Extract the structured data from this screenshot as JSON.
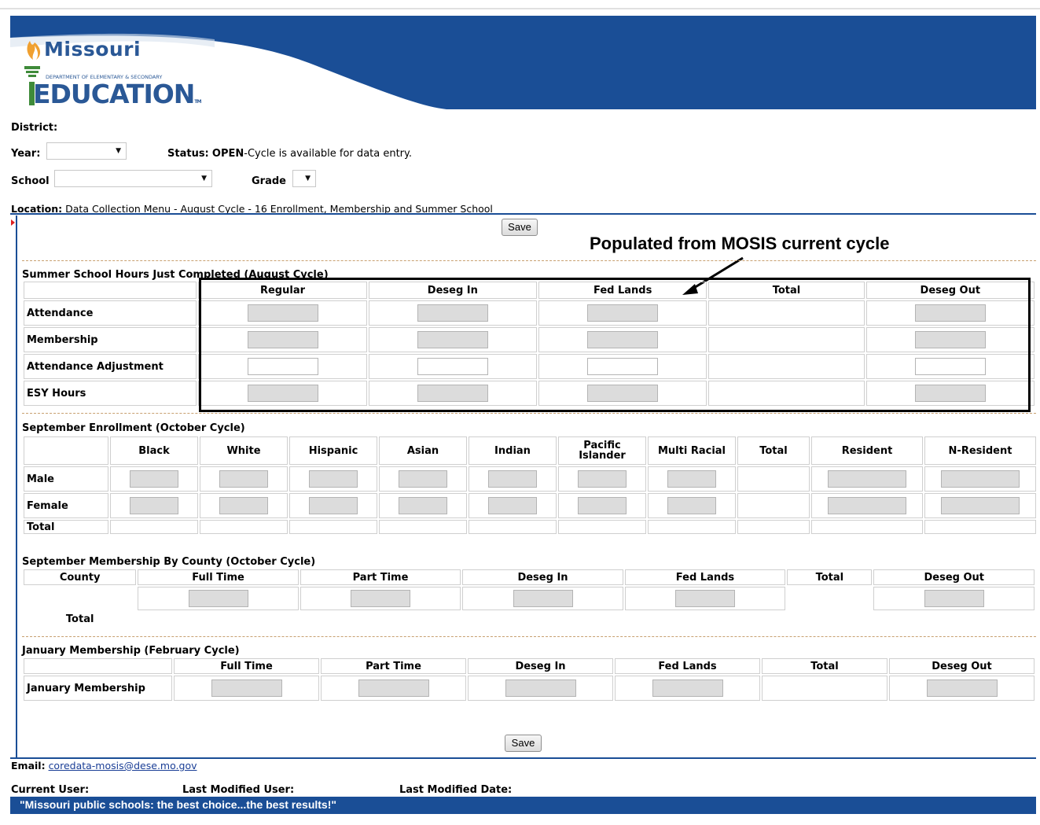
{
  "header": {
    "logo_missouri": "Missouri",
    "logo_department": "DEPARTMENT OF ELEMENTARY & SECONDARY",
    "logo_education": "EDUCATION",
    "logo_tm": "TM",
    "banner_color": "#1a4e96"
  },
  "filters": {
    "district_label": "District:",
    "year_label": "Year:",
    "year_value": "",
    "status_label": "Status:",
    "status_value": "OPEN",
    "status_text": "-Cycle is available for data entry.",
    "school_label": "School",
    "school_value": "",
    "grade_label": "Grade",
    "grade_value": ""
  },
  "location": {
    "label": "Location:",
    "text": "Data Collection Menu - August Cycle - 16 Enrollment, Membership and Summer School"
  },
  "buttons": {
    "save_top": "Save",
    "save_bottom": "Save"
  },
  "annotation": {
    "text": "Populated from MOSIS current cycle"
  },
  "summer": {
    "title": "Summer School Hours Just Completed (August Cycle)",
    "columns": [
      "Regular",
      "Deseg In",
      "Fed Lands",
      "Total",
      "Deseg Out"
    ],
    "rows": [
      "Attendance",
      "Membership",
      "Attendance Adjustment",
      "ESY Hours"
    ]
  },
  "september_enrollment": {
    "title": "September Enrollment (October Cycle)",
    "columns": [
      "Black",
      "White",
      "Hispanic",
      "Asian",
      "Indian",
      "Pacific Islander",
      "Multi Racial",
      "Total",
      "Resident",
      "N-Resident"
    ],
    "rows": [
      "Male",
      "Female",
      "Total"
    ]
  },
  "september_membership": {
    "title": "September Membership By County (October Cycle)",
    "columns": [
      "County",
      "Full Time",
      "Part Time",
      "Deseg In",
      "Fed Lands",
      "Total",
      "Deseg Out"
    ],
    "total_label": "Total"
  },
  "january": {
    "title": "January Membership (February Cycle)",
    "columns": [
      "Full Time",
      "Part Time",
      "Deseg In",
      "Fed Lands",
      "Total",
      "Deseg Out"
    ],
    "row": "January Membership"
  },
  "footer": {
    "email_label": "Email:",
    "email": "coredata-mosis@dese.mo.gov",
    "current_user_label": "Current User:",
    "last_modified_user_label": "Last Modified User:",
    "last_modified_date_label": "Last Modified Date:",
    "slogan": "\"Missouri public schools: the best choice...the best results!\""
  }
}
